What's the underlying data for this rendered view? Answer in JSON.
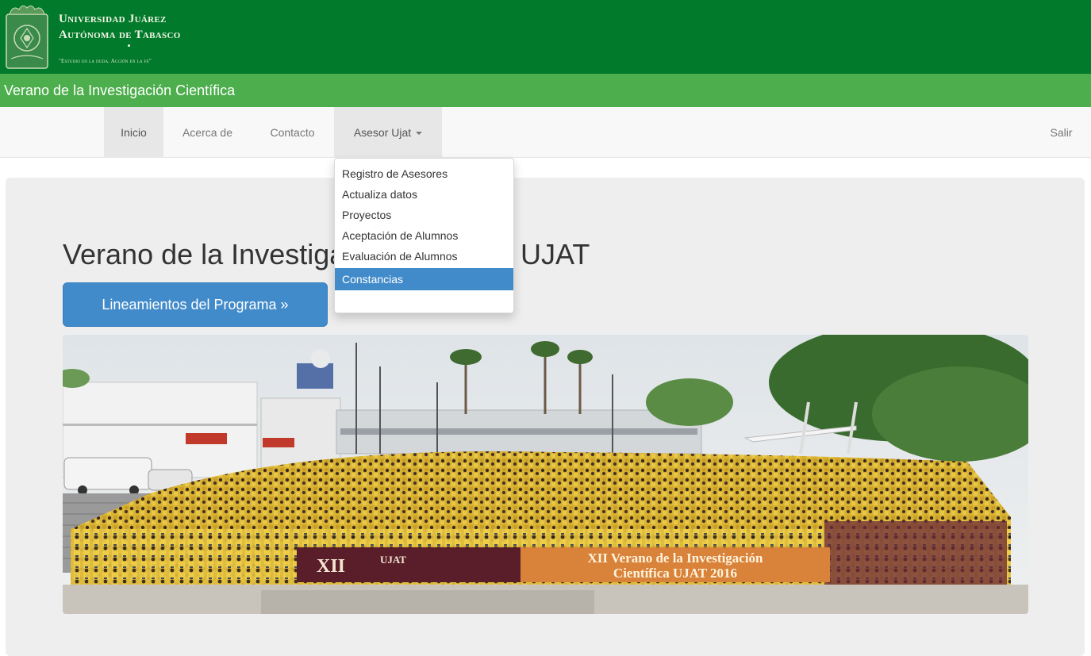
{
  "header": {
    "uni_line1": "Universidad Juárez",
    "uni_line2": "Autónoma de Tabasco",
    "motto": "\"Estudio en la duda. Acción en la fe\"",
    "subtitle": "Verano de la Investigación Científica"
  },
  "nav": {
    "items": [
      {
        "label": "Inicio"
      },
      {
        "label": "Acerca de"
      },
      {
        "label": "Contacto"
      },
      {
        "label": "Asesor Ujat"
      }
    ],
    "logout": "Salir"
  },
  "dropdown": {
    "items": [
      {
        "label": "Registro de Asesores"
      },
      {
        "label": "Actualiza datos"
      },
      {
        "label": "Proyectos"
      },
      {
        "label": "Aceptación de Alumnos"
      },
      {
        "label": "Evaluación de Alumnos"
      },
      {
        "label": "Constancias"
      }
    ]
  },
  "jumbotron": {
    "title_start": "Verano de la Investiga",
    "title_end": "UJAT",
    "button_label": "Lineamientos del Programa »"
  },
  "photo": {
    "banner_numeral": "XII",
    "banner_brand": "UJAT",
    "banner_line1": "XII Verano de la Investigación",
    "banner_line2": "Científica UJAT 2016"
  },
  "colors": {
    "header_green": "#027a2b",
    "subtitle_green": "#4cae4c",
    "primary_blue": "#428bca"
  }
}
